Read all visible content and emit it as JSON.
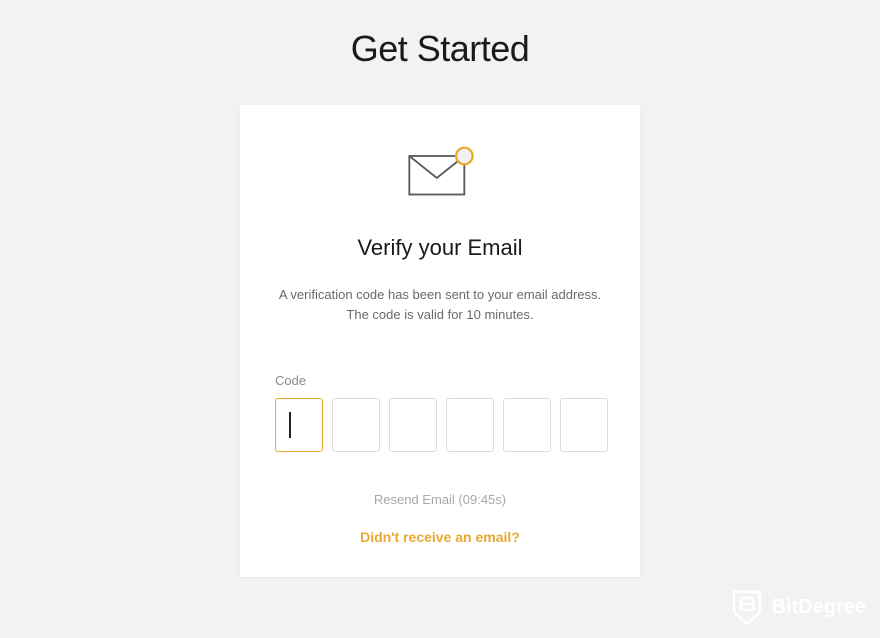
{
  "page_title": "Get Started",
  "card": {
    "heading": "Verify your Email",
    "description_line1": "A verification code has been sent to your email address.",
    "description_line2": "The code is valid for 10 minutes.",
    "code_label": "Code",
    "resend_text": "Resend Email (09:45s)",
    "help_link": "Didn't receive an email?"
  },
  "watermark": {
    "brand": "BitDegree"
  },
  "colors": {
    "accent": "#e8a832",
    "background": "#f2f2f2",
    "card_bg": "#ffffff",
    "text_dark": "#1a1a1a",
    "text_muted": "#6a6a6a"
  },
  "icons": {
    "envelope": "envelope-notification-icon",
    "watermark_logo": "bitdegree-shield-icon"
  }
}
